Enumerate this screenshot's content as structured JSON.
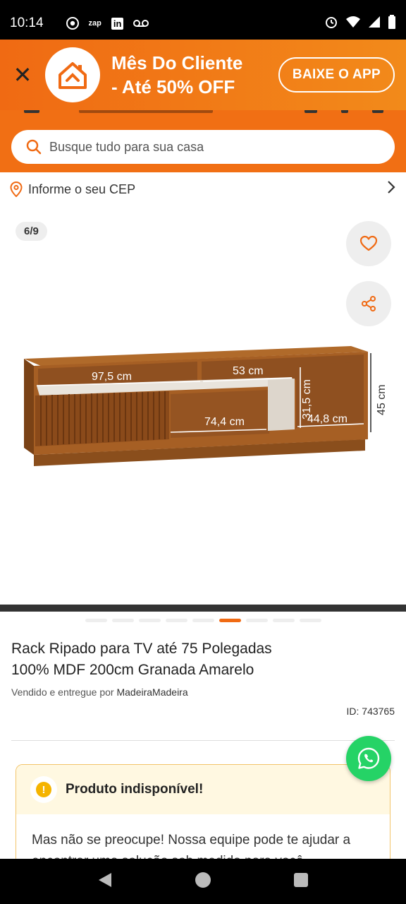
{
  "status_bar": {
    "time": "10:14",
    "icons_left": [
      "chrome-icon",
      "zap-icon",
      "linkedin-icon",
      "voicemail-icon"
    ],
    "zap_label": "zap",
    "linkedin_label": "in",
    "icons_right": [
      "alarm-icon",
      "wifi-icon",
      "signal-icon",
      "battery-icon"
    ]
  },
  "promo": {
    "line1": "Mês Do Cliente",
    "line2": "- Até 50% OFF",
    "app_button": "BAIXE O APP"
  },
  "search": {
    "placeholder": "Busque tudo para sua casa"
  },
  "cep": {
    "label": "Informe o seu CEP"
  },
  "gallery": {
    "counter": "6/9",
    "total_images": 9,
    "active_index": 6,
    "dimensions": {
      "left_width": "97,5 cm",
      "right_width": "53 cm",
      "inner_width": "74,4 cm",
      "height_inner": "31,5 cm",
      "depth": "44,8 cm",
      "height_total": "45 cm"
    }
  },
  "product": {
    "title_line1": "Rack Ripado para TV até 75 Polegadas",
    "title_line2": "100% MDF 200cm Granada Amarelo",
    "seller_prefix": "Vendido e entregue por ",
    "seller_name": "MadeiraMadeira",
    "id": "ID: 743765"
  },
  "alert": {
    "title": "Produto indisponível!",
    "body": "Mas não se preocupe! Nossa equipe pode te ajudar a encontrar uma solução sob medida para você."
  },
  "colors": {
    "brand_orange": "#f06a13",
    "whatsapp_green": "#25d366",
    "alert_yellow": "#f5b400"
  }
}
